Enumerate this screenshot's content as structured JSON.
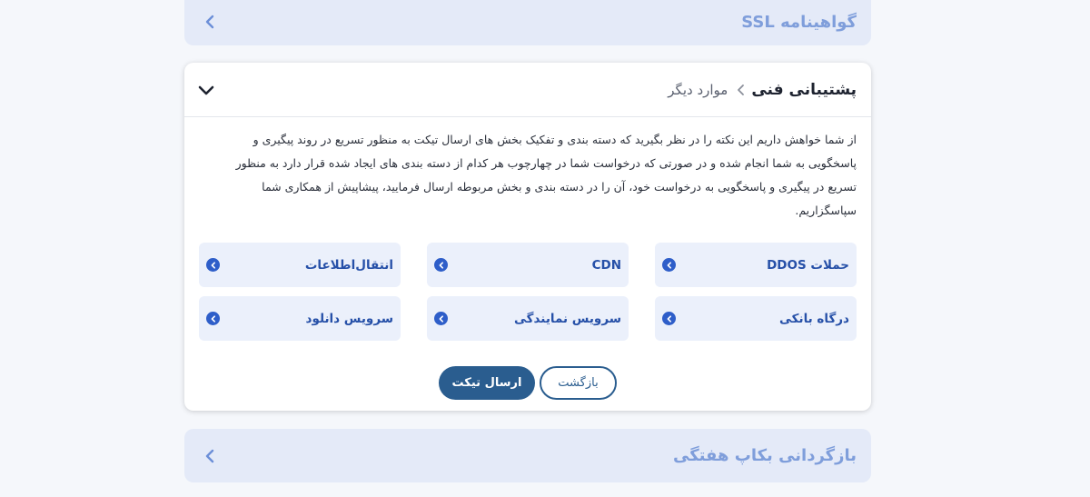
{
  "sections": {
    "ssl": {
      "title": "گواهینامه SSL"
    },
    "backup": {
      "title": "بازگردانی بکاپ هفتگی"
    }
  },
  "card": {
    "title": "پشتیبانی فنی",
    "subtitle": "موارد دیگر",
    "description": "از شما خواهش داریم این نکته را در نظر بگیرید که دسته بندی و تفکیک بخش های ارسال تیکت به منظور تسریع در روند پیگیری و پاسخگویی به شما انجام شده و در صورتی که درخواست شما در چهارچوب هر کدام از دسته بندی های ایجاد شده قرار دارد به منظور تسریع در پیگیری و پاسخگویی به درخواست خود، آن را در دسته بندی و بخش مربوطه ارسال فرمایید، پیشاپیش از همکاری شما سپاسگزاریم.",
    "categories": [
      {
        "label": "حملات DDOS"
      },
      {
        "label": "CDN"
      },
      {
        "label": "انتقال‌اطلاعات"
      },
      {
        "label": "درگاه بانکی"
      },
      {
        "label": "سرویس نمایندگی"
      },
      {
        "label": "سرویس دانلود"
      }
    ],
    "send_label": "ارسال تیکت",
    "back_label": "بازگشت"
  },
  "colors": {
    "accent": "#2a5d8f",
    "category_bg": "#ebf0fb",
    "collapsed_bg": "#e4eaf8"
  }
}
